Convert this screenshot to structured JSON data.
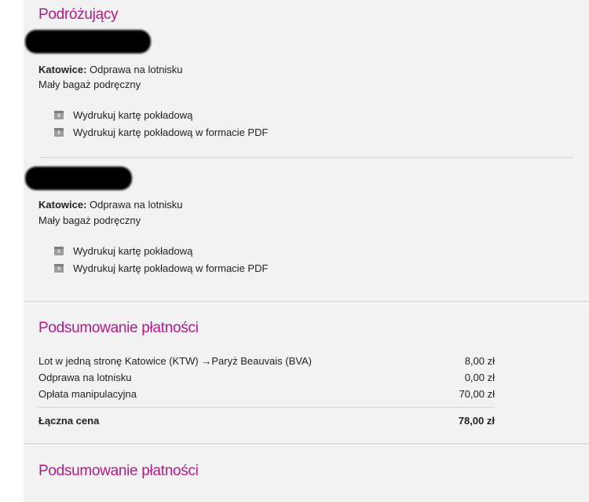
{
  "travelers_section": {
    "title": "Podróżujący",
    "travelers": [
      {
        "checkin_city": "Katowice:",
        "checkin_text": "Odprawa na lotnisku",
        "baggage": "Mały bagaż podręczny",
        "links": [
          {
            "icon": "calendar-icon",
            "icon_digit": "8",
            "label": "Wydrukuj kartę pokładową"
          },
          {
            "icon": "calendar-icon",
            "icon_digit": "8",
            "label": "Wydrukuj kartę pokładową w formacie PDF"
          }
        ]
      },
      {
        "checkin_city": "Katowice:",
        "checkin_text": "Odprawa na lotnisku",
        "baggage": "Mały bagaż podręczny",
        "links": [
          {
            "icon": "calendar-icon",
            "icon_digit": "8",
            "label": "Wydrukuj kartę pokładową"
          },
          {
            "icon": "calendar-icon",
            "icon_digit": "8",
            "label": "Wydrukuj kartę pokładową w formacie PDF"
          }
        ]
      }
    ]
  },
  "payment_summary": {
    "title": "Podsumowanie płatności",
    "rows": [
      {
        "label": "Lot w jedną stronę Katowice (KTW) →Paryż Beauvais (BVA)",
        "value": "8,00 zł"
      },
      {
        "label": "Odprawa na lotnisku",
        "value": "0,00 zł"
      },
      {
        "label": "Opłata manipulacyjna",
        "value": "70,00 zł"
      }
    ],
    "total": {
      "label": "Łączna cena",
      "value": "78,00 zł"
    }
  },
  "payment_summary_2": {
    "title": "Podsumowanie płatności"
  },
  "colors": {
    "heading": "#b01b8e",
    "panel_bg": "#f3f2f2",
    "divider": "#dcdcdc"
  }
}
